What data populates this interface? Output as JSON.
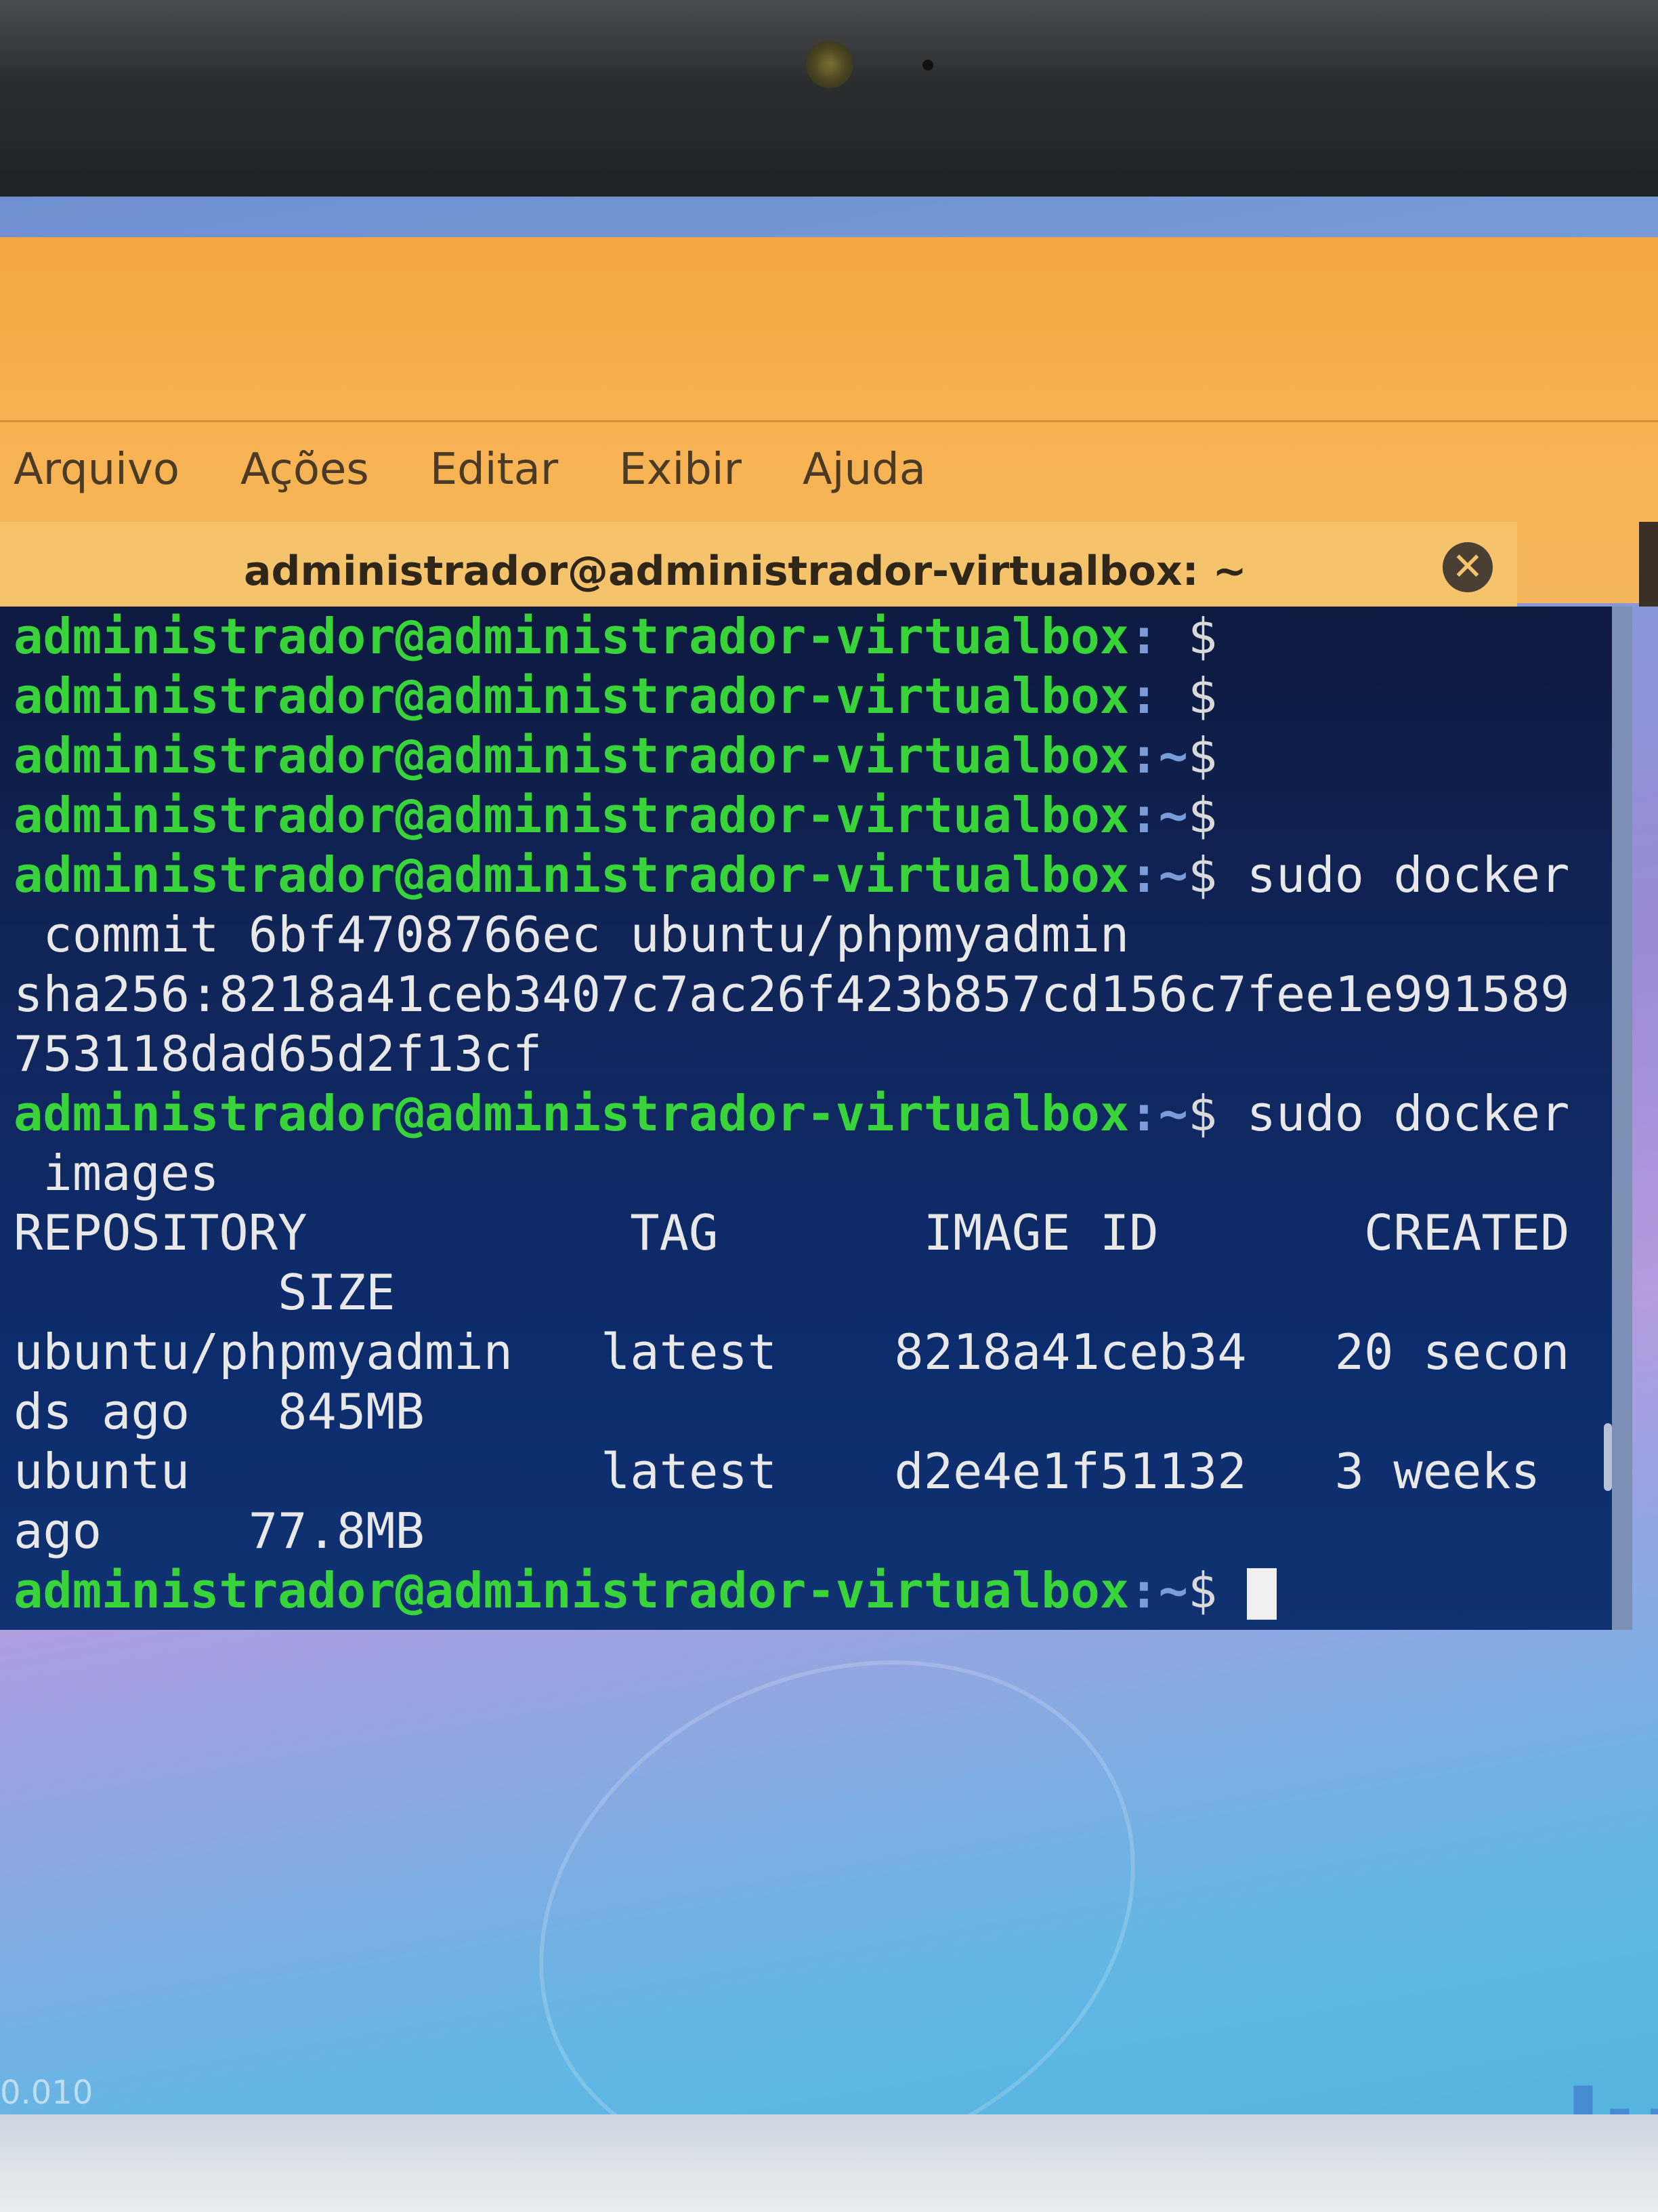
{
  "menu": [
    "Arquivo",
    "Ações",
    "Editar",
    "Exibir",
    "Ajuda"
  ],
  "tab_title": "administrador@administrador-virtualbox: ~",
  "terminal": {
    "prompt_user": "administrador@administrador-virtualbox",
    "lines": [
      {
        "type": "prompt",
        "path": ": ",
        "dollar": "$",
        "cmd": ""
      },
      {
        "type": "prompt",
        "path": ": ",
        "dollar": "$",
        "cmd": ""
      },
      {
        "type": "prompt",
        "path": ":~",
        "dollar": "$",
        "cmd": ""
      },
      {
        "type": "prompt",
        "path": ":~",
        "dollar": "$",
        "cmd": ""
      },
      {
        "type": "prompt",
        "path": ":~",
        "dollar": "$",
        "cmd": " sudo docker"
      },
      {
        "type": "out",
        "text": " commit 6bf4708766ec ubuntu/phpmyadmin"
      },
      {
        "type": "out",
        "text": "sha256:8218a41ceb3407c7ac26f423b857cd156c7fee1e991589"
      },
      {
        "type": "out",
        "text": "753118dad65d2f13cf"
      },
      {
        "type": "prompt",
        "path": ":~",
        "dollar": "$",
        "cmd": " sudo docker"
      },
      {
        "type": "out",
        "text": " images"
      },
      {
        "type": "out",
        "text": "REPOSITORY           TAG       IMAGE ID       CREATED"
      },
      {
        "type": "out",
        "text": "         SIZE"
      },
      {
        "type": "out",
        "text": "ubuntu/phpmyadmin   latest    8218a41ceb34   20 secon"
      },
      {
        "type": "out",
        "text": "ds ago   845MB"
      },
      {
        "type": "out",
        "text": "ubuntu              latest    d2e4e1f51132   3 weeks"
      },
      {
        "type": "out",
        "text": "ago     77.8MB"
      },
      {
        "type": "prompt",
        "path": ":~",
        "dollar": "$",
        "cmd": " ",
        "cursor": true
      }
    ]
  },
  "desktop_text": "0.010",
  "desktop_logo": "lu"
}
